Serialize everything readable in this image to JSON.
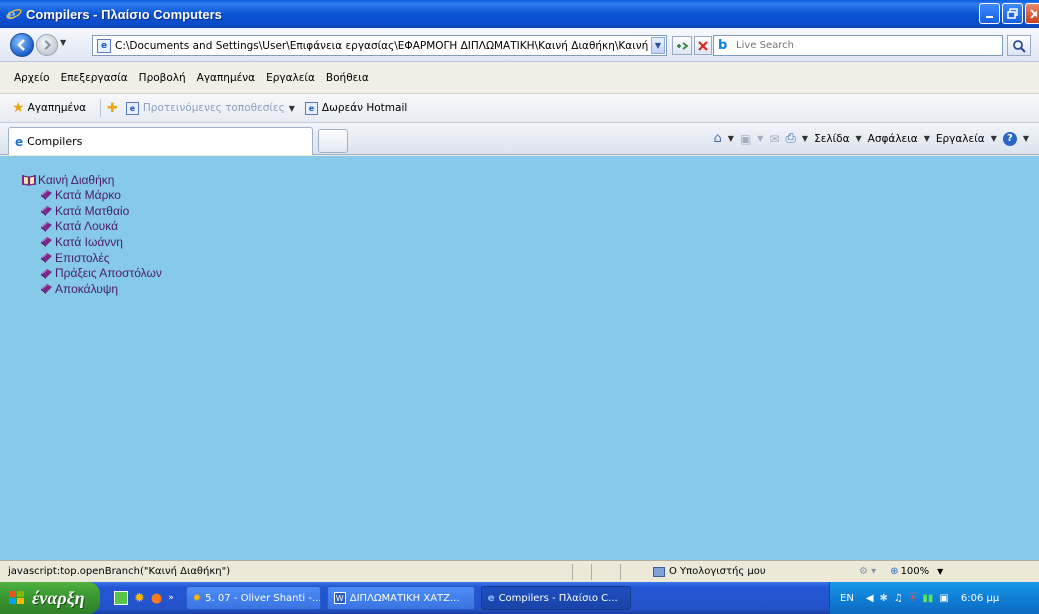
{
  "window": {
    "title": "Compilers - Πλαίσιο Computers"
  },
  "address_bar": {
    "url": "C:\\Documents and Settings\\User\\Επιφάνεια εργασίας\\ΕΦΑΡΜΟΓΗ ΔΙΠΛΩΜΑΤΙΚΗ\\Καινή Διαθήκη\\Καινή Διαθήκη.l",
    "search_placeholder": "Live Search"
  },
  "menu": {
    "items": [
      "Αρχείο",
      "Επεξεργασία",
      "Προβολή",
      "Αγαπημένα",
      "Εργαλεία",
      "Βοήθεια"
    ]
  },
  "favorites_bar": {
    "label": "Αγαπημένα",
    "suggested": "Προτεινόμενες τοποθεσίες",
    "hotmail": "Δωρεάν Hotmail"
  },
  "tab": {
    "label": "Compilers"
  },
  "commands": {
    "page": "Σελίδα",
    "safety": "Ασφάλεια",
    "tools": "Εργαλεία"
  },
  "tree": {
    "root": "Καινή Διαθήκη",
    "children": [
      "Κατά Μάρκο",
      "Κατά Ματθαίο",
      "Κατά Λουκά",
      "Κατά Ιωάννη",
      "Επιστολές",
      "Πράξεις Αποστόλων",
      "Αποκάλυψη"
    ]
  },
  "status": {
    "text": "javascript:top.openBranch(\"Καινή Διαθήκη\")",
    "zone": "Ο Υπολογιστής μου",
    "zoom": "100%"
  },
  "taskbar": {
    "start": "έναρξη",
    "tasks": [
      "5. 07 - Oliver Shanti -...",
      "ΔΙΠΛΩΜΑΤΙΚΗ ΧΑΤΖ...",
      "Compilers - Πλαίσιο C..."
    ],
    "lang": "EN",
    "time": "6:06 μμ"
  },
  "colors": {
    "content_bg": "#87c9e8",
    "tree_text": "#4a1d6b",
    "taskbar_blue": "#2457d6",
    "start_green": "#3c9a33"
  }
}
